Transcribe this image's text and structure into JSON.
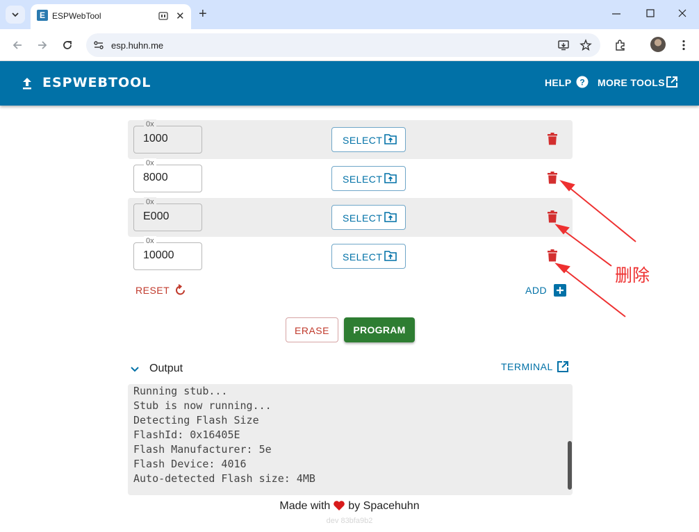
{
  "browser": {
    "tab_title": "ESPWebTool",
    "tab_favicon_letter": "E",
    "new_tab_glyph": "+",
    "close_tab_glyph": "✕",
    "url": "esp.huhn.me"
  },
  "header": {
    "title": "ESPWEBTOOL",
    "help_label": "HELP",
    "more_tools_label": "MORE TOOLS"
  },
  "partitions": {
    "prefix": "0x",
    "select_label": "SELECT",
    "rows": [
      {
        "offset": "1000"
      },
      {
        "offset": "8000"
      },
      {
        "offset": "E000"
      },
      {
        "offset": "10000"
      }
    ]
  },
  "actions": {
    "reset_label": "RESET",
    "add_label": "ADD",
    "erase_label": "ERASE",
    "program_label": "PROGRAM"
  },
  "output": {
    "title": "Output",
    "terminal_label": "TERMINAL",
    "lines": [
      "Running stub...",
      "Stub is now running...",
      "Detecting Flash Size",
      "FlashId: 0x16405E",
      "Flash Manufacturer: 5e",
      "Flash Device: 4016",
      "Auto-detected Flash size: 4MB"
    ]
  },
  "footer": {
    "made_with": "Made with",
    "by": "by Spacehuhn",
    "version": "dev 83bfa9b2"
  },
  "annotation": {
    "text": "删除",
    "color": "#ee3030"
  },
  "colors": {
    "brand": "#0171a7",
    "program": "#2e7d32",
    "danger": "#c0392b",
    "delete_icon": "#d32f2f"
  }
}
